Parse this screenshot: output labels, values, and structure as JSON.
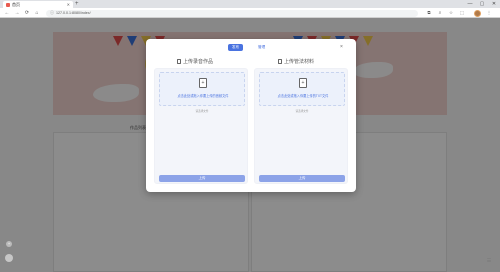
{
  "browser": {
    "tab_title": "首页",
    "new_tab": "+",
    "win_min": "—",
    "win_max": "▢",
    "win_close": "✕",
    "url": "127.0.0.1:8080/index/",
    "nav_back": "←",
    "nav_forward": "→",
    "nav_reload": "⟳",
    "nav_home": "⌂"
  },
  "page": {
    "section_label": "作品列表"
  },
  "modal": {
    "tab_active": "发布",
    "tab_inactive": "管理",
    "close": "×",
    "left_panel": {
      "title": "上传录音作品",
      "drop_text": "点击此处或拖入你要上传的音频文件",
      "hint": "请选择文件",
      "button": "上传"
    },
    "right_panel": {
      "title": "上传管法材料",
      "drop_text": "点击此处或拖入你要上传的TXT文件",
      "hint": "请选择文件",
      "button": "上传"
    }
  },
  "colors": {
    "accent": "#4a73e0",
    "button": "#8ca3e8",
    "banner": "#f2d3cf"
  }
}
